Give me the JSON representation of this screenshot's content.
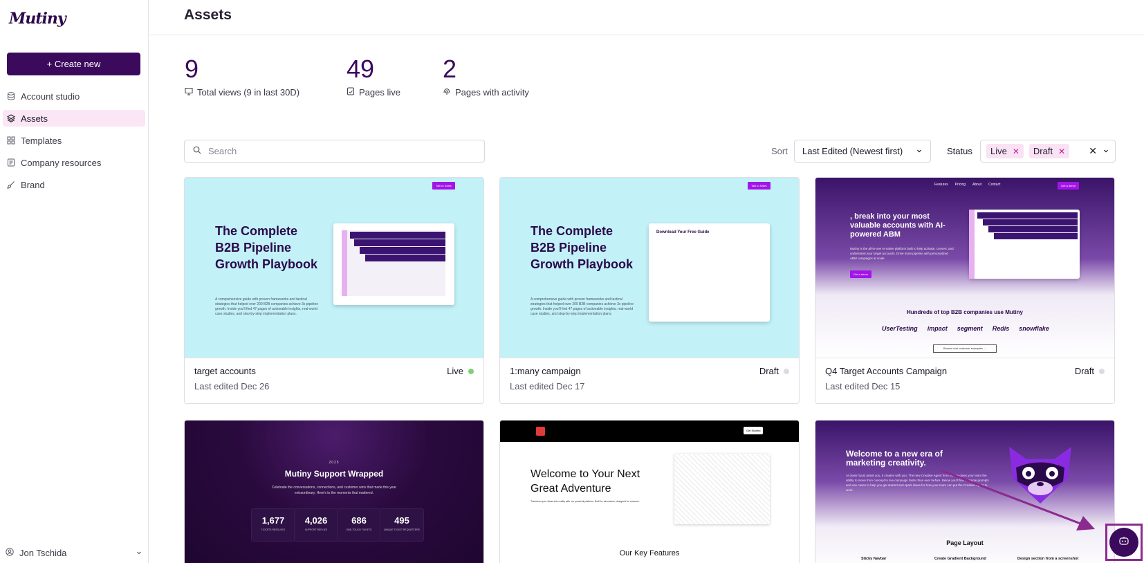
{
  "app": {
    "logo": "Mutiny"
  },
  "sidebar": {
    "create_label": "+ Create new",
    "items": [
      {
        "label": "Account studio",
        "icon": "database-icon"
      },
      {
        "label": "Assets",
        "icon": "layers-icon"
      },
      {
        "label": "Templates",
        "icon": "grid-icon"
      },
      {
        "label": "Company resources",
        "icon": "file-icon"
      },
      {
        "label": "Brand",
        "icon": "brush-icon"
      }
    ],
    "user": "Jon Tschida"
  },
  "header": {
    "title": "Assets"
  },
  "stats": [
    {
      "value": "9",
      "label": "Total views (9 in last 30D)"
    },
    {
      "value": "49",
      "label": "Pages live"
    },
    {
      "value": "2",
      "label": "Pages with activity"
    }
  ],
  "filters": {
    "search_placeholder": "Search",
    "sort_label": "Sort",
    "sort_value": "Last Edited (Newest first)",
    "status_label": "Status",
    "status_chips": [
      "Live",
      "Draft"
    ]
  },
  "cards": [
    {
      "name": "target accounts",
      "date": "Last edited Dec 26",
      "status": "Live",
      "status_color": "#7fd07a"
    },
    {
      "name": "1:many campaign",
      "date": "Last edited Dec 17",
      "status": "Draft",
      "status_color": "#dcdbe0"
    },
    {
      "name": "Q4 Target Accounts Campaign",
      "date": "Last edited Dec 15",
      "status": "Draft",
      "status_color": "#dcdbe0"
    }
  ],
  "thumbs": {
    "playbook_title": "The Complete B2B Pipeline Growth Playbook",
    "playbook_desc": "A comprehensive guide with proven frameworks and tactical strategies that helped over 200 B2B companies achieve 3x pipeline growth. Inside you'll find 47 pages of actionable insights, real-world case studies, and step-by-step implementation plans.",
    "talk_to_sales": "Talk to Sales",
    "download_title": "Download Your Free Guide",
    "abm_nav": [
      "Features",
      "Pricing",
      "About",
      "Contact"
    ],
    "abm_cta": "Get a demo",
    "abm_title": ", break into your most valuable accounts with AI-powered ABM",
    "abm_desc": "Mutiny is the all-in-one AI-native platform built to help activate, convert, and understand your target accounts. Drive more pipeline with personalized ABM campaigns at scale.",
    "abm_hundreds": "Hundreds of top B2B companies use Mutiny",
    "abm_logos": [
      "UserTesting",
      "impact",
      "segment",
      "Redis",
      "snowflake"
    ],
    "abm_browse": "Browse real customer examples →",
    "wrapped_year": "2025",
    "wrapped_title": "Mutiny Support Wrapped",
    "wrapped_desc": "Celebrate the conversations, connections, and customer wins that made this year extraordinary. Here's to the moments that mattered.",
    "wrapped_stats": [
      {
        "n": "1,677",
        "l": "TICKETS RESOLVED"
      },
      {
        "n": "4,026",
        "l": "SUPPORT REPLIES"
      },
      {
        "n": "686",
        "l": "ONE-TOUCH TICKETS"
      },
      {
        "n": "495",
        "l": "UNIQUE TICKET REQUESTERS"
      }
    ],
    "adv_cta": "Get Started",
    "adv_title": "Welcome to Your Next Great Adventure",
    "adv_desc": "Transform your ideas into reality with our powerful platform. Built for innovators, designed for success.",
    "adv_features": "Our Key Features",
    "era_title": "Welcome to a new era of marketing creativity.",
    "era_desc": "AI doesn't just assist you, it creates with you. The new Creative Agent from Mutiny gives your team the ability to move from concept to live campaign faster than ever before. Below you'll find example prompts and use cases to help you get started and spark ideas for how your team can put the Creative Agent to work.",
    "era_layout": "Page Layout",
    "era_cols": [
      "Sticky Navbar",
      "Create Gradient Background",
      "Design section from a screenshot"
    ]
  },
  "colors": {
    "brand": "#3b0a5c",
    "accent": "#a314e8",
    "chip_bg": "#f9e2f4"
  }
}
